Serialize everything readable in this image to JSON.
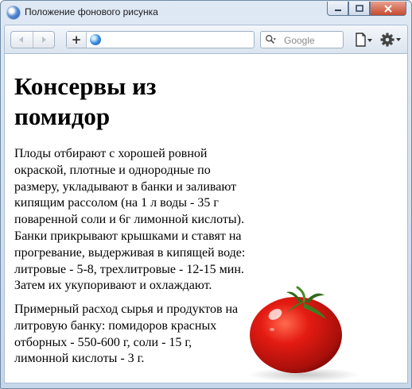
{
  "window": {
    "title": "Положение фонового рисунка",
    "controls": [
      "minimize",
      "maximize",
      "close"
    ]
  },
  "toolbar": {
    "back_icon": "back-arrow-icon",
    "forward_icon": "forward-arrow-icon",
    "new_tab_label": "+",
    "address_value": "",
    "search_placeholder": "Google",
    "page_menu_icon": "page-icon",
    "settings_menu_icon": "gear-icon"
  },
  "page": {
    "heading": "Консервы из помидор",
    "paragraph1": "Плоды отбирают с хорошей ровной окраской, плотные и однородные по размеру, укладывают в банки и заливают кипящим рассолом (на 1 л воды - 35 г поваренной соли и 6г лимонной кислоты). Банки прикрывают крышками и ставят на прогревание, выдерживая в кипящей воде: литровые - 5-8, трехлитровые - 12-15 мин. Затем их укупоривают и охлаждают.",
    "paragraph2": "Примерный расход сырья и продуктов на литровую банку: помидоров красных отборных - 550-600 г, соли - 15 г, лимонной кислоты - 3 г."
  },
  "colors": {
    "window_frame": "#c7d7ea",
    "close_button": "#c84a30",
    "tomato": "#d81810"
  }
}
